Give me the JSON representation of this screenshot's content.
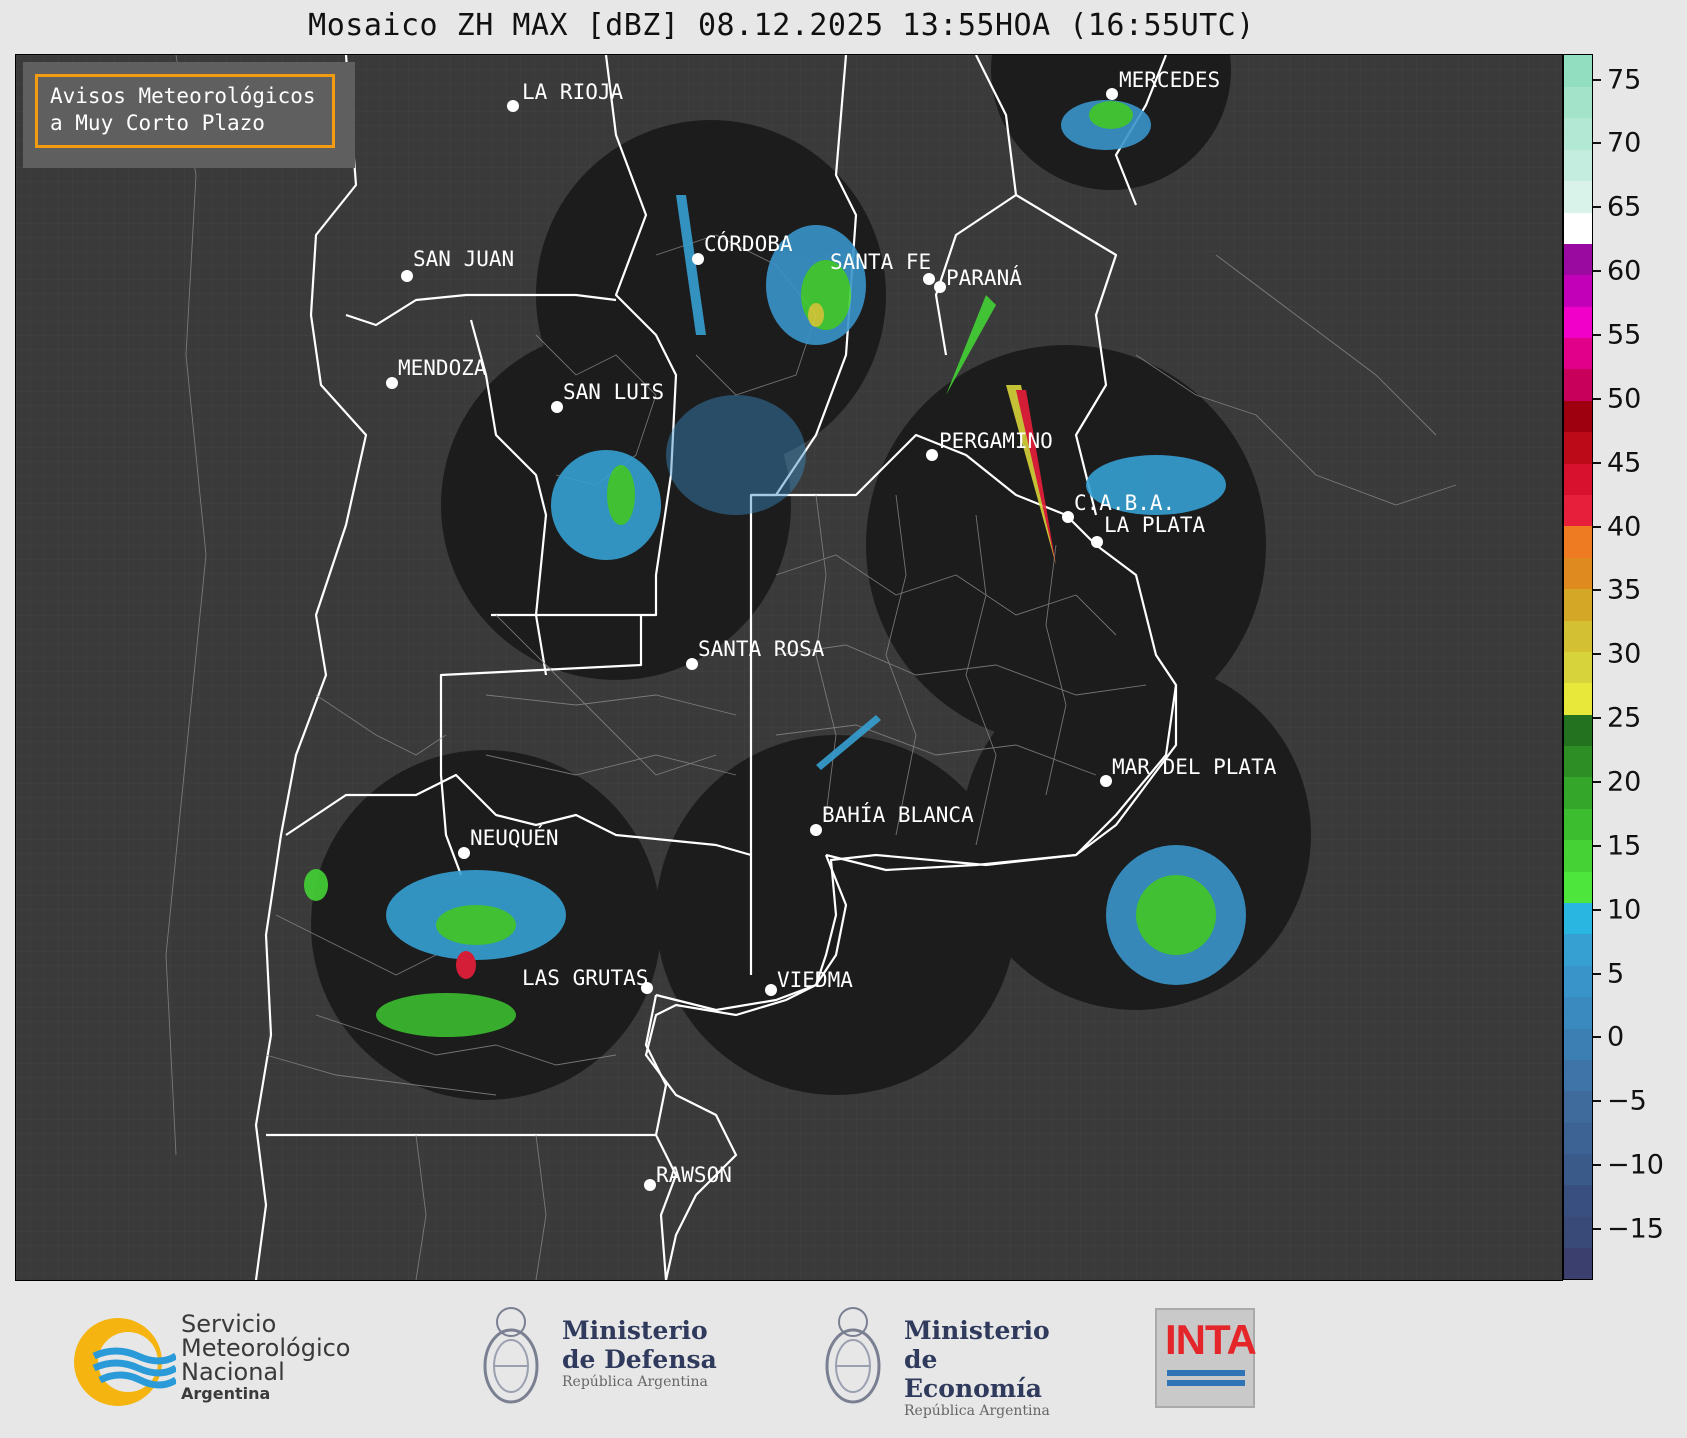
{
  "title": "Mosaico ZH MAX [dBZ] 08.12.2025 13:55HOA (16:55UTC)",
  "avisos": {
    "line1": "Avisos Meteorológicos",
    "line2": "a Muy Corto Plazo"
  },
  "cities": [
    {
      "name": "LA RIOJA"
    },
    {
      "name": "SAN JUAN"
    },
    {
      "name": "MENDOZA"
    },
    {
      "name": "SAN LUIS"
    },
    {
      "name": "CÓRDOBA"
    },
    {
      "name": "SANTA FE"
    },
    {
      "name": "PARANÁ"
    },
    {
      "name": "MERCEDES"
    },
    {
      "name": "PERGAMINO"
    },
    {
      "name": "C.A.B.A."
    },
    {
      "name": "LA PLATA"
    },
    {
      "name": "SANTA ROSA"
    },
    {
      "name": "NEUQUÉN"
    },
    {
      "name": "BAHÍA BLANCA"
    },
    {
      "name": "MAR DEL PLATA"
    },
    {
      "name": "LAS GRUTAS"
    },
    {
      "name": "VIEDMA"
    },
    {
      "name": "RAWSON"
    }
  ],
  "colorbar": {
    "unit": "dBZ",
    "min": -19,
    "max": 77,
    "ticks": [
      "75",
      "70",
      "65",
      "60",
      "55",
      "50",
      "45",
      "40",
      "35",
      "30",
      "25",
      "20",
      "15",
      "10",
      "5",
      "0",
      "−5",
      "−10",
      "−15"
    ],
    "tick_values": [
      75,
      70,
      65,
      60,
      55,
      50,
      45,
      40,
      35,
      30,
      25,
      20,
      15,
      10,
      5,
      0,
      -5,
      -10,
      -15
    ],
    "colors": [
      "#3b3f6e",
      "#3a4a78",
      "#394f80",
      "#3a5a8a",
      "#3d6394",
      "#3f6b9c",
      "#3f74a8",
      "#3b7fb3",
      "#3a89bf",
      "#3894c9",
      "#36a0d2",
      "#29b6e0",
      "#4ce63c",
      "#44d235",
      "#3cbd2f",
      "#34a62a",
      "#2c8e25",
      "#237220",
      "#e8e83a",
      "#d7d33a",
      "#d3c033",
      "#d4a826",
      "#de8a1f",
      "#ee7a22",
      "#e81f3a",
      "#d8112e",
      "#bd0a18",
      "#9e0010",
      "#c8005c",
      "#e1008a",
      "#f000c8",
      "#c200b8",
      "#9a0aa0",
      "#ffffff",
      "#d9f2ea",
      "#c5eddf",
      "#b3e8d4",
      "#a2e3ca",
      "#92deC0"
    ]
  },
  "logos": {
    "smn": {
      "line1": "Servicio",
      "line2": "Meteorológico",
      "line3": "Nacional",
      "line4": "Argentina"
    },
    "defensa": {
      "line1": "Ministerio",
      "line2": "de Defensa",
      "line3": "República Argentina"
    },
    "economia": {
      "line1": "Ministerio",
      "line2": "de Economía",
      "line3": "República Argentina"
    },
    "inta": {
      "text": "INTA"
    }
  }
}
